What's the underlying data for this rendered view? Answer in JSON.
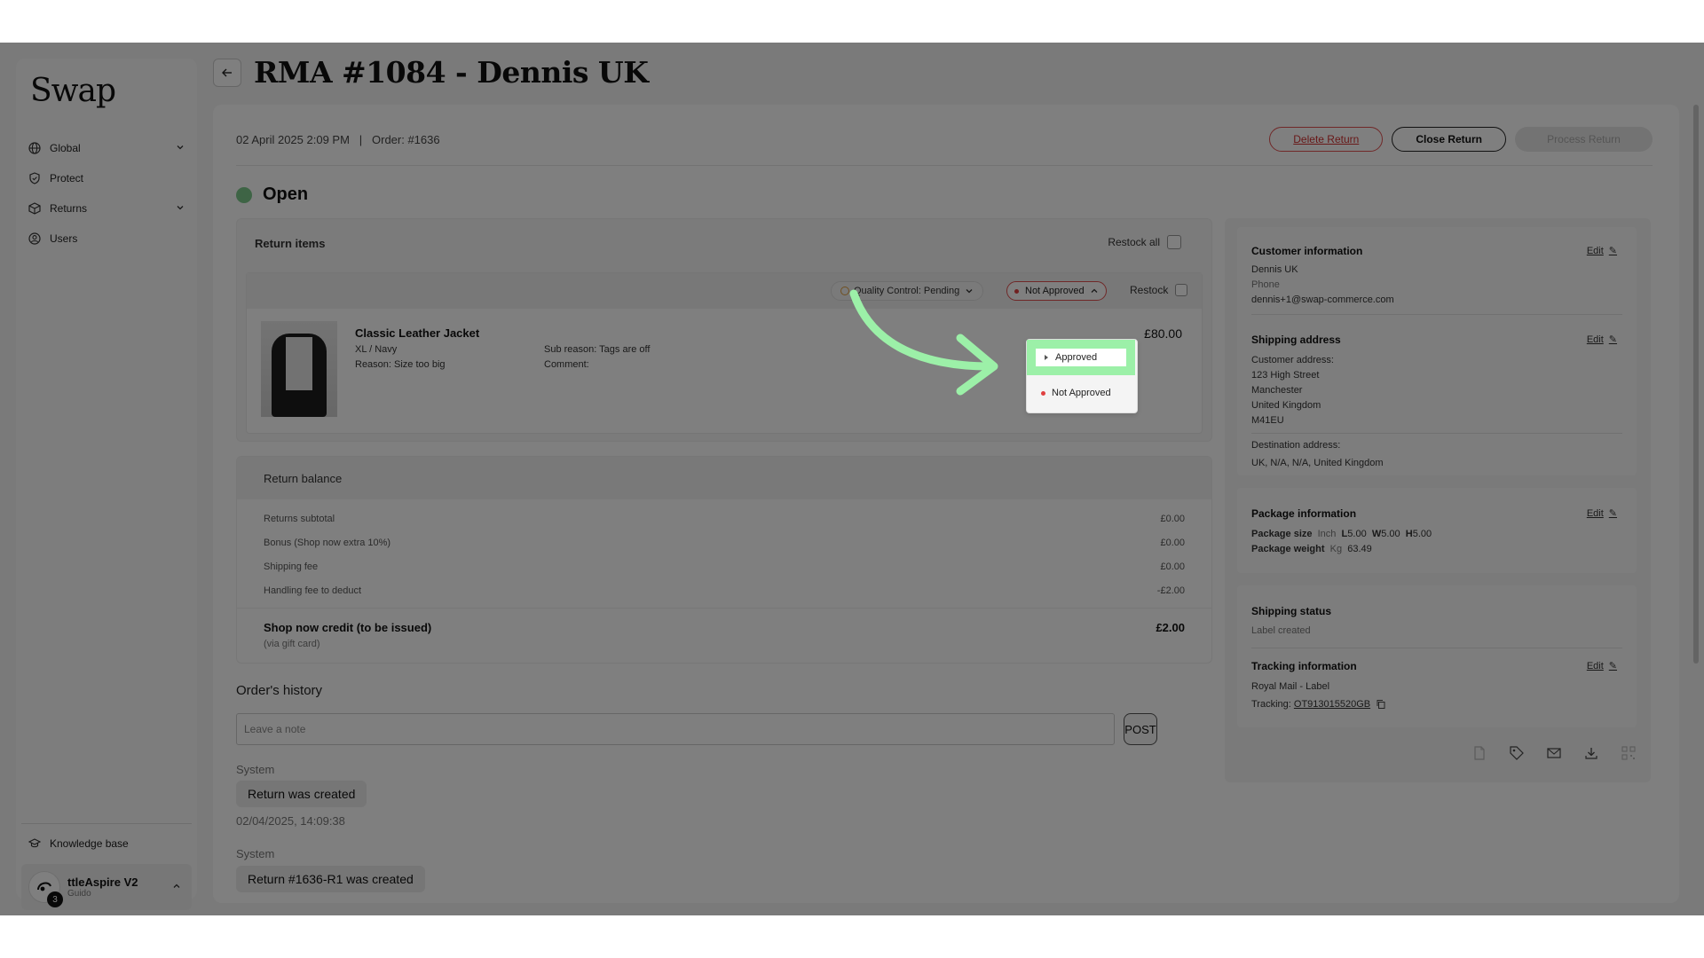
{
  "sidebar": {
    "logo": "Swap",
    "items": [
      {
        "label": "Global",
        "icon": "globe-icon",
        "expandable": true
      },
      {
        "label": "Protect",
        "icon": "shield-icon",
        "expandable": false
      },
      {
        "label": "Returns",
        "icon": "box-icon",
        "expandable": true
      },
      {
        "label": "Users",
        "icon": "user-circle-icon",
        "expandable": false
      }
    ],
    "knowledge_base": "Knowledge base",
    "account": {
      "name": "ttleAspire V2",
      "sub": "Guido",
      "badge": "3"
    }
  },
  "header": {
    "title": "RMA #1084 - Dennis UK"
  },
  "main": {
    "date": "02 April 2025 2:09 PM",
    "separator": "|",
    "order": "Order: #1636",
    "actions": {
      "delete": "Delete Return",
      "close": "Close Return",
      "process": "Process Return"
    },
    "status": "Open",
    "return_items": {
      "title": "Return items",
      "restock_all": "Restock all",
      "item": {
        "qc_status": "Quality Control: Pending",
        "approval": "Not Approved",
        "restock": "Restock",
        "name": "Classic Leather Jacket",
        "variant": "XL / Navy",
        "reason": "Reason: Size too big",
        "sub_reason": "Sub reason: Tags are off",
        "comment": "Comment:",
        "price": "£80.00"
      },
      "dropdown_options": [
        "Approved",
        "Not Approved"
      ]
    },
    "balance": {
      "title": "Return balance",
      "rows": [
        {
          "label": "Returns subtotal",
          "value": "£0.00"
        },
        {
          "label": "Bonus (Shop now extra 10%)",
          "value": "£0.00"
        },
        {
          "label": "Shipping fee",
          "value": "£0.00"
        },
        {
          "label": "Handling fee to deduct",
          "value": "-£2.00"
        }
      ],
      "total_label": "Shop now credit (to be issued)",
      "total_sub": "(via gift card)",
      "total_value": "£2.00"
    },
    "history": {
      "title": "Order's history",
      "note_placeholder": "Leave a note",
      "post": "POST",
      "entries": [
        {
          "author": "System",
          "text": "Return was created",
          "time": "02/04/2025, 14:09:38"
        },
        {
          "author": "System",
          "text": "Return #1636-R1 was created",
          "time": ""
        }
      ]
    }
  },
  "right_panel": {
    "edit_label": "Edit",
    "customer": {
      "title": "Customer information",
      "name": "Dennis UK",
      "phone": "Phone",
      "email": "dennis+1@swap-commerce.com"
    },
    "shipping": {
      "title": "Shipping address",
      "customer_label": "Customer address:",
      "lines": [
        "123 High Street",
        "Manchester",
        "United Kingdom",
        "M41EU"
      ],
      "destination_label": "Destination address:",
      "destination": "UK, N/A, N/A, United Kingdom"
    },
    "package": {
      "title": "Package information",
      "size_label": "Package size",
      "unit": "Inch",
      "l": "5.00",
      "w": "5.00",
      "h": "5.00",
      "weight_label": "Package weight",
      "weight_unit": "Kg",
      "weight": "63.49"
    },
    "shipping_status": {
      "title": "Shipping status",
      "value": "Label created"
    },
    "tracking": {
      "title": "Tracking information",
      "carrier": "Royal Mail - Label",
      "label": "Tracking:",
      "number": "OT913015520GB"
    }
  },
  "colors": {
    "accent_green": "#9cf0a8",
    "status_open": "#7cc98a",
    "danger": "#d03030"
  }
}
